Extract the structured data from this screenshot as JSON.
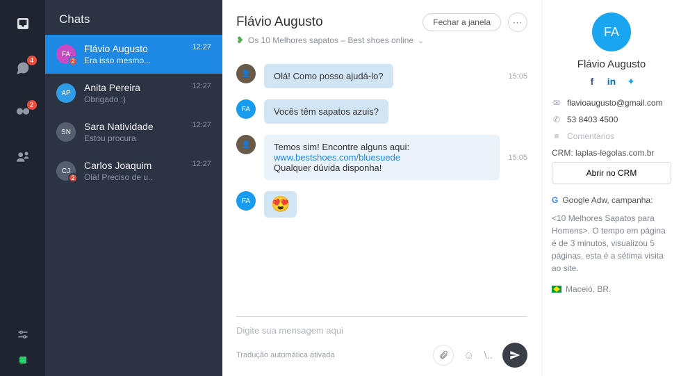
{
  "rail": {
    "badges": {
      "chat": "4",
      "bino": "2"
    }
  },
  "chatlist": {
    "title": "Chats",
    "items": [
      {
        "name": "Flávio Augusto",
        "preview": "Era isso mesmo...",
        "time": "12:27",
        "initials": "FA",
        "color": "#C94BC4",
        "badge": "2"
      },
      {
        "name": "Anita Pereira",
        "preview": "Obrigado :)",
        "time": "12:27",
        "initials": "AP",
        "color": "#2E9CE6",
        "badge": ""
      },
      {
        "name": "Sara Natividade",
        "preview": "Estou procura",
        "time": "12:27",
        "initials": "SN",
        "color": "#565F70",
        "badge": ""
      },
      {
        "name": "Carlos Joaquim",
        "preview": "Olá! Preciso de u..",
        "time": "12:27",
        "initials": "CJ",
        "color": "#565F70",
        "badge": "2"
      }
    ]
  },
  "conv": {
    "title": "Flávio Augusto",
    "close_label": "Fechar a janela",
    "subhead": "Os 10 Melhores sapatos – Best shoes online",
    "messages": {
      "m1": {
        "text": "Olá! Como posso ajudá-lo?",
        "time": "15:05"
      },
      "m2": {
        "text": "Vocês têm sapatos azuis?"
      },
      "m3": {
        "text1": "Temos sim! Encontre alguns aqui:  ",
        "link": "www.bestshoes.com/bluesuede",
        "text2": "Qualquer dúvida disponha!",
        "time": "15:05"
      },
      "m4": {
        "emoji": "😍"
      }
    },
    "composer": {
      "placeholder": "Digite sua mensagem aqui",
      "translation": "Tradução automática ativada",
      "slash": "\\.."
    }
  },
  "details": {
    "initials": "FA",
    "name": "Flávio Augusto",
    "email": "flavioaugusto@gmail.com",
    "phone": "53 8403 4500",
    "comments_placeholder": "Comentários",
    "crm_label": "CRM: laplas-legolas.com.br",
    "crm_button": "Abrir no CRM",
    "adwords": "Google Adw, campanha:",
    "description": "<10 Melhores Sapatos para Homens>. O tempo em página é de 3 minutos, visualizou 5 páginas, esta é a sétima visita ao site.",
    "location": "Maceió, BR."
  }
}
